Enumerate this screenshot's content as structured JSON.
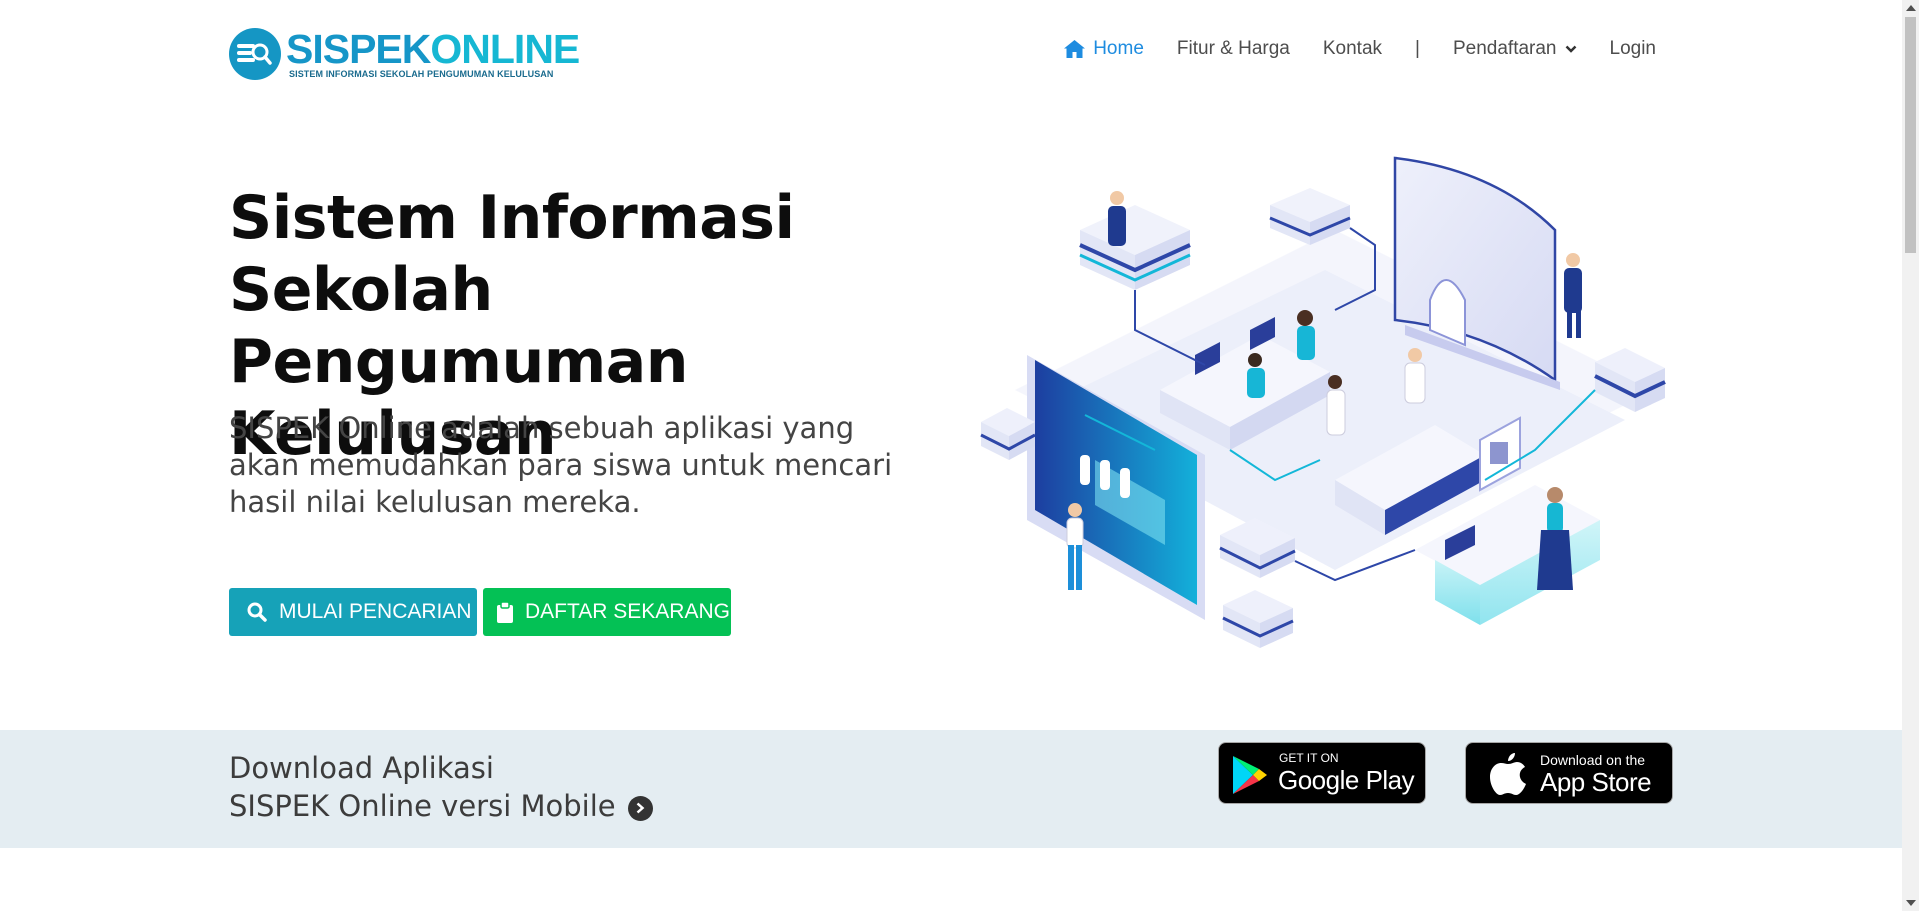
{
  "brand": {
    "name_part1": "SISPEK",
    "name_part2": "ONLINE",
    "tagline": "SISTEM INFORMASI SEKOLAH PENGUMUMAN KELULUSAN",
    "primary_color": "#1696c8",
    "secondary_color": "#16b7d3"
  },
  "nav": {
    "items": [
      {
        "label": "Home",
        "icon": "home-icon",
        "active": true
      },
      {
        "label": "Fitur & Harga"
      },
      {
        "label": "Kontak"
      },
      {
        "label": "|"
      },
      {
        "label": "Pendaftaran",
        "icon": "chevron-down-icon"
      },
      {
        "label": "Login"
      }
    ],
    "active_color": "#1e8ce0"
  },
  "hero": {
    "title": "Sistem Informasi Sekolah Pengumuman Kelulusan",
    "description": "SISPEK Online adalah sebuah aplikasi yang akan memudahkan para siswa untuk mencari hasil nilai kelulusan mereka.",
    "btn_search_label": "MULAI PENCARIAN",
    "btn_search_icon": "search-icon",
    "btn_search_color": "#16a2b8",
    "btn_register_label": "DAFTAR SEKARANG",
    "btn_register_icon": "clipboard-icon",
    "btn_register_color": "#04c155"
  },
  "download": {
    "line1": "Download Aplikasi",
    "line2": "SISPEK Online versi Mobile",
    "google_play": {
      "small": "GET IT ON",
      "big": "Google Play"
    },
    "app_store": {
      "small": "Download on the",
      "big": "App Store"
    },
    "band_color": "#e4edf2"
  }
}
